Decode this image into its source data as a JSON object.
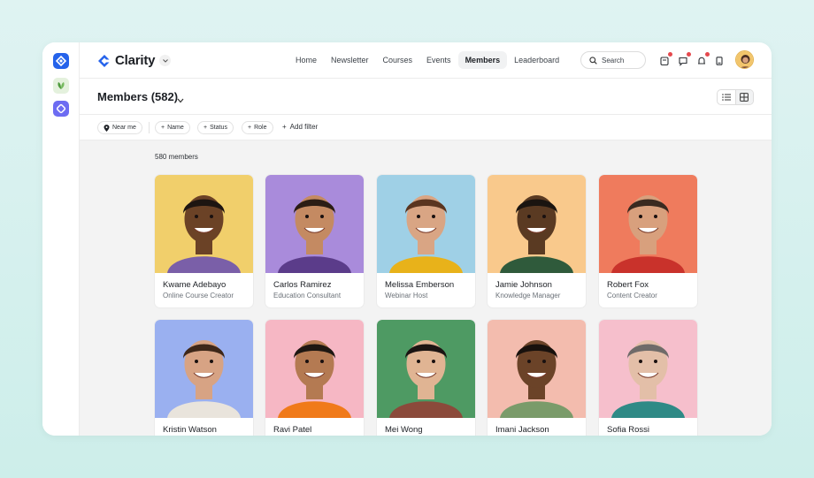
{
  "brand": {
    "name": "Clarity",
    "accent": "#2563eb"
  },
  "rail": [
    {
      "name": "clarity-app-icon",
      "color": "#2563eb"
    },
    {
      "name": "leaf-app-icon",
      "color": "#dcefd6"
    },
    {
      "name": "sync-app-icon",
      "color": "#6d6cf2"
    }
  ],
  "nav": [
    "Home",
    "Newsletter",
    "Courses",
    "Events",
    "Members",
    "Leaderboard"
  ],
  "nav_active": "Members",
  "search": {
    "label": "Search"
  },
  "page": {
    "title": "Members (582)"
  },
  "filters": {
    "near_me": "Near me",
    "name": "Name",
    "status": "Status",
    "role": "Role",
    "add_filter": "Add filter"
  },
  "members_count": "580 members",
  "members": [
    {
      "name": "Kwame Adebayo",
      "role": "Online Course Creator",
      "bg": "#f1cf6b"
    },
    {
      "name": "Carlos Ramirez",
      "role": "Education Consultant",
      "bg": "#a98bdb"
    },
    {
      "name": "Melissa Emberson",
      "role": "Webinar Host",
      "bg": "#9fd0e6"
    },
    {
      "name": "Jamie Johnson",
      "role": "Knowledge Manager",
      "bg": "#f9c98c"
    },
    {
      "name": "Robert Fox",
      "role": "Content Creator",
      "bg": "#ef7b5d"
    },
    {
      "name": "Kristin Watson",
      "role": "",
      "bg": "#9ab0f0"
    },
    {
      "name": "Ravi Patel",
      "role": "",
      "bg": "#f6b7c4"
    },
    {
      "name": "Mei Wong",
      "role": "",
      "bg": "#4e9a63"
    },
    {
      "name": "Imani Jackson",
      "role": "",
      "bg": "#f3bcae"
    },
    {
      "name": "Sofia Rossi",
      "role": "",
      "bg": "#f6bfcc"
    }
  ]
}
